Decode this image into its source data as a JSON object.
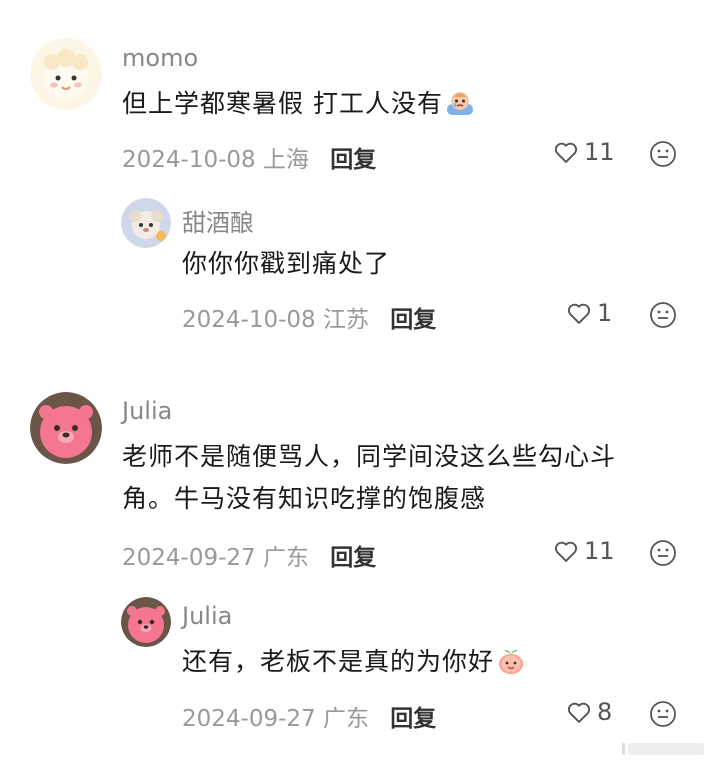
{
  "comments": [
    {
      "username": "momo",
      "text": "但上学都寒暑假 打工人没有",
      "date": "2024-10-08",
      "location": "上海",
      "reply_label": "回复",
      "likes": "11",
      "replies": [
        {
          "username": "甜酒酿",
          "text": "你你你戳到痛处了",
          "date": "2024-10-08",
          "location": "江苏",
          "reply_label": "回复",
          "likes": "1"
        }
      ]
    },
    {
      "username": "Julia",
      "text_line1": "老师不是随便骂人，同学间没这么些勾心斗",
      "text_line2": "角。牛马没有知识吃撑的饱腹感",
      "date": "2024-09-27",
      "location": "广东",
      "reply_label": "回复",
      "likes": "11",
      "replies": [
        {
          "username": "Julia",
          "text": "还有，老板不是真的为你好",
          "date": "2024-09-27",
          "location": "广东",
          "reply_label": "回复",
          "likes": "8"
        }
      ]
    }
  ]
}
